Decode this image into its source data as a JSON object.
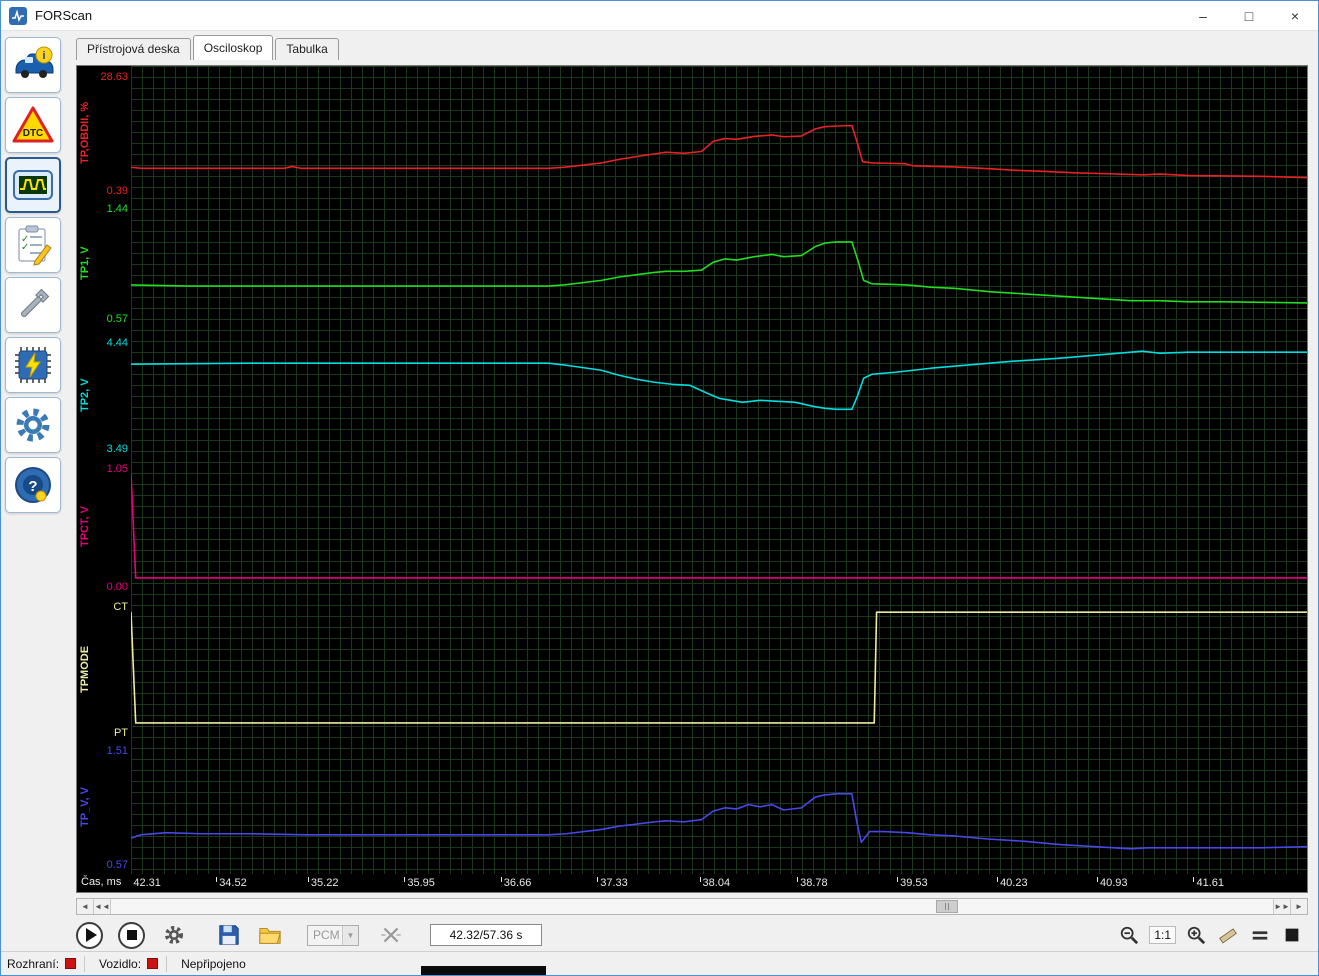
{
  "window": {
    "title": "FORScan",
    "controls": {
      "minimize": "–",
      "maximize": "□",
      "close": "×"
    }
  },
  "tabs": [
    {
      "label": "Přístrojová deska",
      "active": false
    },
    {
      "label": "Osciloskop",
      "active": true
    },
    {
      "label": "Tabulka",
      "active": false
    }
  ],
  "sidebar": {
    "items": [
      "vehicle-info",
      "read-dtc",
      "oscilloscope",
      "tests",
      "service",
      "programming",
      "settings",
      "about"
    ]
  },
  "chart_data": {
    "type": "line",
    "xlabel": "Čas, ms",
    "grid": true,
    "background": "#000000",
    "x_ticks": [
      {
        "label": "42.31",
        "pos": 0.002
      },
      {
        "label": "34.52",
        "pos": 0.075
      },
      {
        "label": "35.22",
        "pos": 0.153
      },
      {
        "label": "35.95",
        "pos": 0.235
      },
      {
        "label": "36.66",
        "pos": 0.317
      },
      {
        "label": "37.33",
        "pos": 0.399
      },
      {
        "label": "38.04",
        "pos": 0.486
      },
      {
        "label": "38.78",
        "pos": 0.569
      },
      {
        "label": "39.53",
        "pos": 0.654
      },
      {
        "label": "40.23",
        "pos": 0.739
      },
      {
        "label": "40.93",
        "pos": 0.824
      },
      {
        "label": "41.61",
        "pos": 0.906
      }
    ],
    "channels": [
      {
        "name": "TP,OBDII, %",
        "color": "#e82222",
        "max_label": "28.63",
        "min_label": "0.39",
        "min": 0.39,
        "max": 28.63,
        "points": [
          [
            0,
            4.6
          ],
          [
            0.01,
            4.3
          ],
          [
            0.13,
            4.3
          ],
          [
            0.137,
            4.8
          ],
          [
            0.145,
            4.3
          ],
          [
            0.355,
            4.3
          ],
          [
            0.368,
            4.6
          ],
          [
            0.4,
            5.8
          ],
          [
            0.415,
            6.8
          ],
          [
            0.43,
            7.6
          ],
          [
            0.445,
            8.3
          ],
          [
            0.455,
            8.8
          ],
          [
            0.47,
            8.5
          ],
          [
            0.485,
            9.0
          ],
          [
            0.495,
            11.8
          ],
          [
            0.505,
            12.6
          ],
          [
            0.515,
            12.4
          ],
          [
            0.53,
            13.2
          ],
          [
            0.545,
            13.6
          ],
          [
            0.555,
            13.1
          ],
          [
            0.57,
            13.3
          ],
          [
            0.582,
            15.3
          ],
          [
            0.59,
            15.9
          ],
          [
            0.6,
            16.1
          ],
          [
            0.613,
            16.2
          ],
          [
            0.618,
            11.0
          ],
          [
            0.622,
            6.2
          ],
          [
            0.63,
            5.8
          ],
          [
            0.658,
            5.6
          ],
          [
            0.665,
            5.0
          ],
          [
            0.7,
            4.7
          ],
          [
            0.73,
            4.2
          ],
          [
            0.75,
            3.8
          ],
          [
            0.78,
            3.4
          ],
          [
            0.8,
            3.1
          ],
          [
            0.83,
            2.8
          ],
          [
            0.86,
            2.5
          ],
          [
            0.875,
            2.7
          ],
          [
            0.9,
            2.3
          ],
          [
            0.93,
            2.2
          ],
          [
            0.96,
            2.1
          ],
          [
            1,
            1.7
          ]
        ]
      },
      {
        "name": "TP1, V",
        "color": "#22dd22",
        "max_label": "1.44",
        "min_label": "0.57",
        "min": 0.57,
        "max": 1.44,
        "points": [
          [
            0,
            0.8
          ],
          [
            0.05,
            0.79
          ],
          [
            0.355,
            0.79
          ],
          [
            0.368,
            0.8
          ],
          [
            0.4,
            0.84
          ],
          [
            0.415,
            0.87
          ],
          [
            0.43,
            0.89
          ],
          [
            0.445,
            0.91
          ],
          [
            0.455,
            0.92
          ],
          [
            0.47,
            0.92
          ],
          [
            0.485,
            0.93
          ],
          [
            0.495,
            1.0
          ],
          [
            0.505,
            1.03
          ],
          [
            0.515,
            1.02
          ],
          [
            0.53,
            1.05
          ],
          [
            0.545,
            1.07
          ],
          [
            0.555,
            1.05
          ],
          [
            0.57,
            1.06
          ],
          [
            0.582,
            1.14
          ],
          [
            0.59,
            1.17
          ],
          [
            0.6,
            1.18
          ],
          [
            0.613,
            1.18
          ],
          [
            0.618,
            1.02
          ],
          [
            0.623,
            0.84
          ],
          [
            0.63,
            0.81
          ],
          [
            0.66,
            0.8
          ],
          [
            0.68,
            0.78
          ],
          [
            0.7,
            0.77
          ],
          [
            0.73,
            0.74
          ],
          [
            0.76,
            0.72
          ],
          [
            0.79,
            0.7
          ],
          [
            0.82,
            0.68
          ],
          [
            0.85,
            0.66
          ],
          [
            0.875,
            0.66
          ],
          [
            0.9,
            0.65
          ],
          [
            0.93,
            0.65
          ],
          [
            1,
            0.64
          ]
        ]
      },
      {
        "name": "TP2, V",
        "color": "#00dede",
        "max_label": "4.44",
        "min_label": "3.49",
        "min": 3.49,
        "max": 4.44,
        "points": [
          [
            0,
            4.26
          ],
          [
            0.1,
            4.27
          ],
          [
            0.355,
            4.27
          ],
          [
            0.37,
            4.25
          ],
          [
            0.4,
            4.2
          ],
          [
            0.415,
            4.15
          ],
          [
            0.43,
            4.11
          ],
          [
            0.445,
            4.08
          ],
          [
            0.46,
            4.06
          ],
          [
            0.475,
            4.05
          ],
          [
            0.49,
            3.97
          ],
          [
            0.5,
            3.92
          ],
          [
            0.51,
            3.9
          ],
          [
            0.52,
            3.88
          ],
          [
            0.535,
            3.9
          ],
          [
            0.55,
            3.89
          ],
          [
            0.565,
            3.88
          ],
          [
            0.58,
            3.84
          ],
          [
            0.59,
            3.82
          ],
          [
            0.6,
            3.81
          ],
          [
            0.613,
            3.81
          ],
          [
            0.618,
            3.95
          ],
          [
            0.623,
            4.12
          ],
          [
            0.63,
            4.16
          ],
          [
            0.65,
            4.18
          ],
          [
            0.68,
            4.22
          ],
          [
            0.71,
            4.25
          ],
          [
            0.75,
            4.29
          ],
          [
            0.79,
            4.32
          ],
          [
            0.83,
            4.36
          ],
          [
            0.86,
            4.39
          ],
          [
            0.875,
            4.37
          ],
          [
            0.9,
            4.38
          ],
          [
            0.95,
            4.38
          ],
          [
            1,
            4.38
          ]
        ]
      },
      {
        "name": "TPCT, V",
        "color": "#e8007c",
        "max_label": "1.05",
        "min_label": "0.00",
        "min": 0,
        "max": 1.05,
        "points": [
          [
            0,
            1.05
          ],
          [
            0.004,
            0
          ],
          [
            1,
            0
          ]
        ]
      },
      {
        "name": "TPMODE",
        "color": "#ececa0",
        "max_label": "CT",
        "min_label": "PT",
        "min": 0,
        "max": 1,
        "points": [
          [
            0,
            1
          ],
          [
            0.004,
            0
          ],
          [
            0.632,
            0
          ],
          [
            0.634,
            1
          ],
          [
            1,
            1
          ]
        ]
      },
      {
        "name": "TP_V, V",
        "color": "#4848e8",
        "max_label": "1.51",
        "min_label": "0.57",
        "min": 0.57,
        "max": 1.51,
        "points": [
          [
            0,
            0.74
          ],
          [
            0.008,
            0.77
          ],
          [
            0.03,
            0.79
          ],
          [
            0.06,
            0.78
          ],
          [
            0.1,
            0.78
          ],
          [
            0.15,
            0.77
          ],
          [
            0.355,
            0.77
          ],
          [
            0.37,
            0.78
          ],
          [
            0.4,
            0.82
          ],
          [
            0.415,
            0.85
          ],
          [
            0.43,
            0.87
          ],
          [
            0.445,
            0.89
          ],
          [
            0.455,
            0.9
          ],
          [
            0.47,
            0.89
          ],
          [
            0.485,
            0.91
          ],
          [
            0.495,
            0.99
          ],
          [
            0.505,
            1.02
          ],
          [
            0.515,
            1.01
          ],
          [
            0.525,
            1.05
          ],
          [
            0.535,
            1.03
          ],
          [
            0.545,
            1.05
          ],
          [
            0.555,
            1.0
          ],
          [
            0.57,
            1.02
          ],
          [
            0.582,
            1.12
          ],
          [
            0.59,
            1.14
          ],
          [
            0.6,
            1.15
          ],
          [
            0.613,
            1.15
          ],
          [
            0.617,
            0.9
          ],
          [
            0.621,
            0.7
          ],
          [
            0.628,
            0.8
          ],
          [
            0.64,
            0.8
          ],
          [
            0.66,
            0.79
          ],
          [
            0.68,
            0.77
          ],
          [
            0.7,
            0.76
          ],
          [
            0.73,
            0.73
          ],
          [
            0.76,
            0.71
          ],
          [
            0.79,
            0.68
          ],
          [
            0.82,
            0.66
          ],
          [
            0.85,
            0.64
          ],
          [
            0.865,
            0.65
          ],
          [
            0.88,
            0.65
          ],
          [
            0.92,
            0.65
          ],
          [
            0.96,
            0.65
          ],
          [
            1,
            0.66
          ]
        ]
      }
    ]
  },
  "scrollbar": {
    "left": "◄",
    "left_double": "◄◄",
    "right_double": "►►",
    "right": "►"
  },
  "transport": {
    "module": "PCM",
    "dropdown_arrow": "▼",
    "time": "42.32/57.36 s",
    "zoom_ratio": "1:1"
  },
  "status_bar": {
    "interface_label": "Rozhraní:",
    "vehicle_label": "Vozidlo:",
    "status": "Nepřipojeno"
  }
}
